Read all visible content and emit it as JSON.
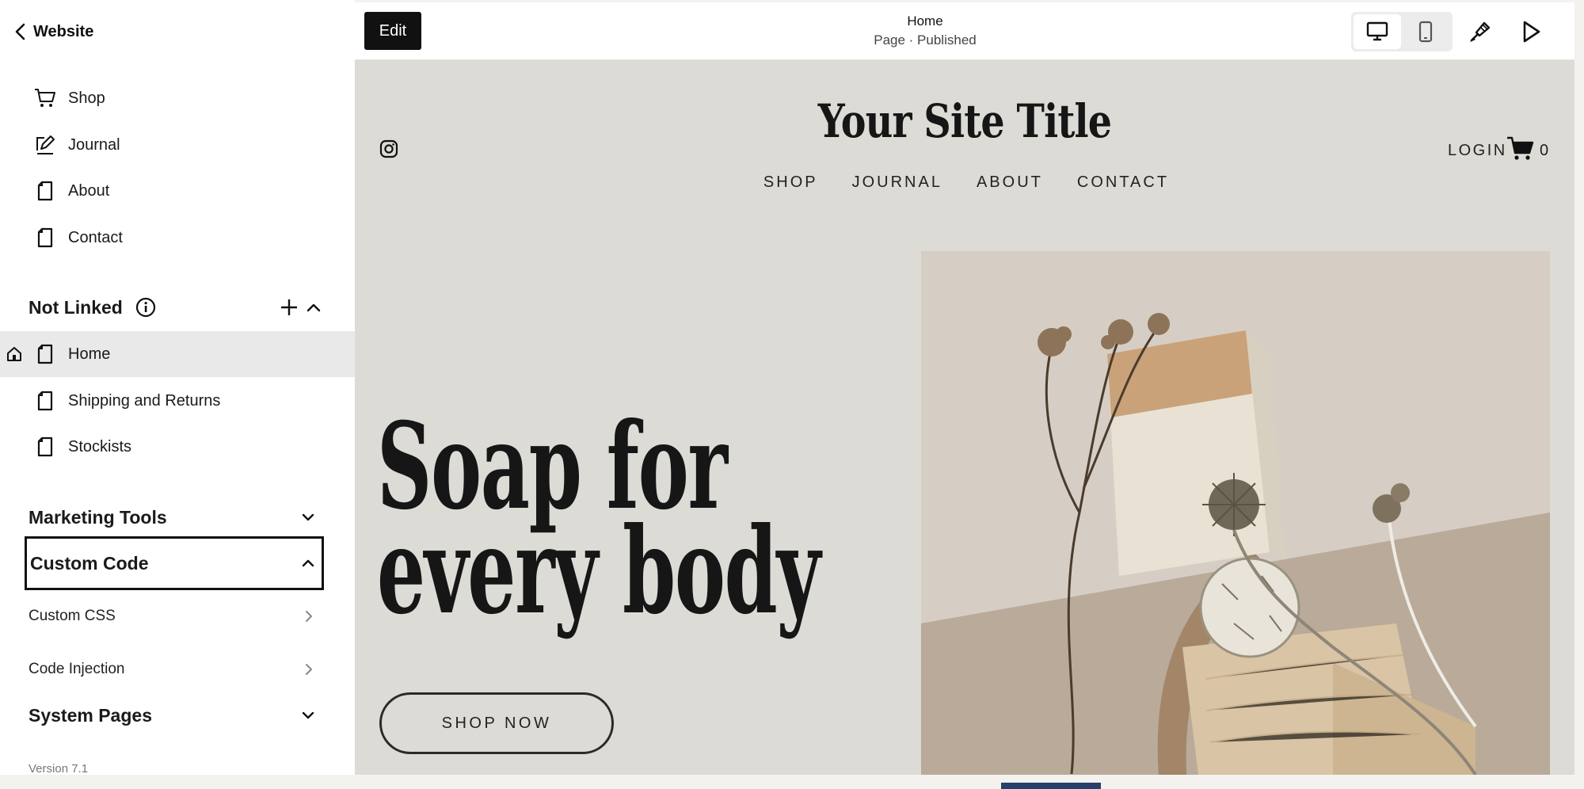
{
  "sidebar": {
    "back_label": "Website",
    "main_nav": [
      {
        "label": "Shop",
        "icon": "cart-icon"
      },
      {
        "label": "Journal",
        "icon": "blog-icon"
      },
      {
        "label": "About",
        "icon": "page-icon"
      },
      {
        "label": "Contact",
        "icon": "page-icon"
      }
    ],
    "not_linked": {
      "title": "Not Linked",
      "items": [
        {
          "label": "Home",
          "icon": "page-icon",
          "active": true
        },
        {
          "label": "Shipping and Returns",
          "icon": "page-icon"
        },
        {
          "label": "Stockists",
          "icon": "page-icon"
        }
      ]
    },
    "marketing_tools": "Marketing Tools",
    "custom_code": {
      "title": "Custom Code",
      "items": [
        "Custom CSS",
        "Code Injection"
      ]
    },
    "system_pages": "System Pages",
    "version": "Version 7.1"
  },
  "topbar": {
    "edit_label": "Edit",
    "page_name": "Home",
    "page_status": "Page · Published"
  },
  "site": {
    "title": "Your Site Title",
    "nav": [
      "SHOP",
      "JOURNAL",
      "ABOUT",
      "CONTACT"
    ],
    "login": "LOGIN",
    "cart_count": "0",
    "hero_line1": "Soap for",
    "hero_line2": "every body",
    "cta": "SHOP NOW"
  },
  "colors": {
    "sidebar_bg": "#ffffff",
    "preview_bg": "#dcdbd6",
    "active_row": "#e9e9e9",
    "accent_dark": "#111111"
  }
}
